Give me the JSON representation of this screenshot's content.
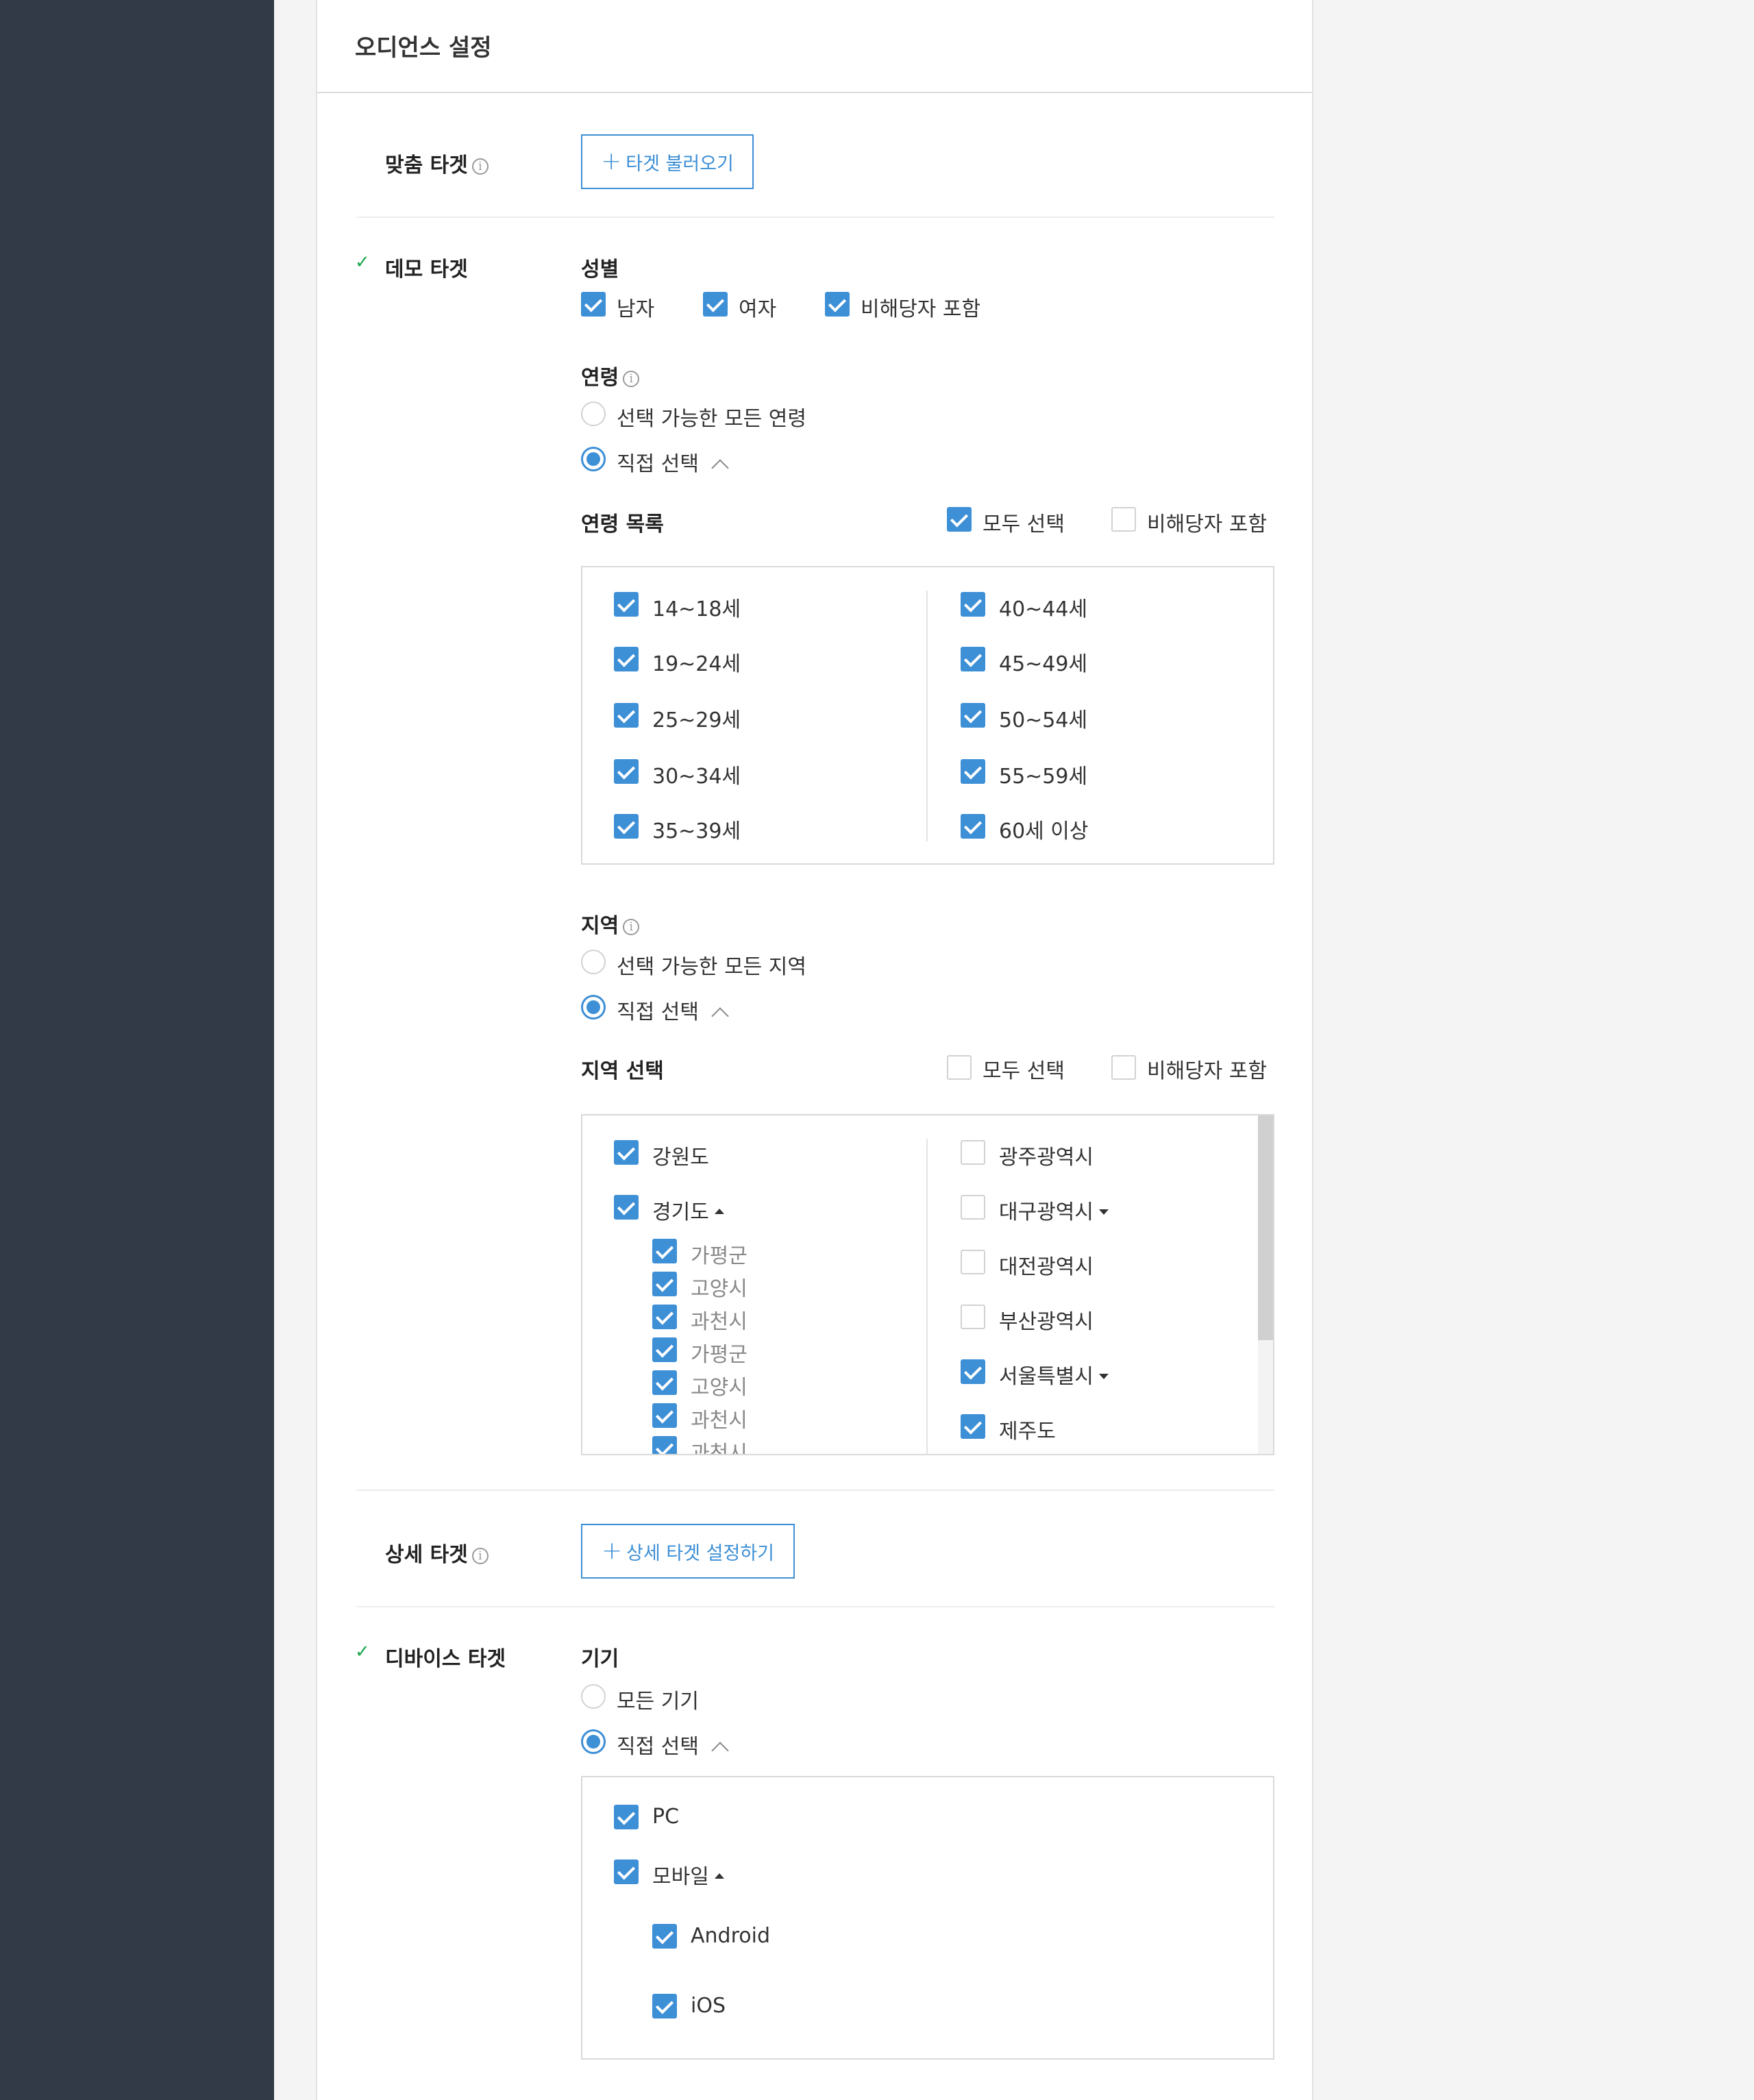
{
  "page": {
    "title": "오디언스 설정"
  },
  "custom_target": {
    "label": "맞춤 타겟",
    "button": "타겟 불러오기"
  },
  "demo_target": {
    "label": "데모 타겟",
    "gender": {
      "title": "성별",
      "options": [
        {
          "label": "남자",
          "checked": true
        },
        {
          "label": "여자",
          "checked": true
        },
        {
          "label": "비해당자 포함",
          "checked": true
        }
      ]
    },
    "age": {
      "title": "연령",
      "radio_all": "선택 가능한 모든 연령",
      "radio_custom": "직접 선택",
      "list_title": "연령 목록",
      "select_all": "모두 선택",
      "select_all_checked": true,
      "include_na": "비해당자 포함",
      "include_na_checked": false,
      "left": [
        "14~18세",
        "19~24세",
        "25~29세",
        "30~34세",
        "35~39세"
      ],
      "right": [
        "40~44세",
        "45~49세",
        "50~54세",
        "55~59세",
        "60세 이상"
      ]
    },
    "region": {
      "title": "지역",
      "radio_all": "선택 가능한 모든 지역",
      "radio_custom": "직접 선택",
      "list_title": "지역 선택",
      "select_all": "모두 선택",
      "select_all_checked": false,
      "include_na": "비해당자 포함",
      "include_na_checked": false,
      "left": [
        {
          "label": "강원도",
          "checked": true
        },
        {
          "label": "경기도",
          "checked": true,
          "expanded": true
        }
      ],
      "left_children": [
        "가평군",
        "고양시",
        "과천시",
        "가평군",
        "고양시",
        "과천시",
        "과천시"
      ],
      "right": [
        {
          "label": "광주광역시",
          "checked": false
        },
        {
          "label": "대구광역시",
          "checked": false,
          "has_children": true
        },
        {
          "label": "대전광역시",
          "checked": false
        },
        {
          "label": "부산광역시",
          "checked": false
        },
        {
          "label": "서울특별시",
          "checked": true,
          "has_children": true
        },
        {
          "label": "제주도",
          "checked": true
        }
      ]
    }
  },
  "detail_target": {
    "label": "상세 타겟",
    "button": "상세 타겟 설정하기"
  },
  "device_target": {
    "label": "디바이스 타겟",
    "device": {
      "title": "기기",
      "radio_all": "모든 기기",
      "radio_custom": "직접 선택",
      "items": [
        {
          "label": "PC",
          "checked": true
        },
        {
          "label": "모바일",
          "checked": true,
          "expanded": true
        }
      ],
      "children": [
        "Android",
        "iOS"
      ]
    }
  },
  "colors": {
    "accent": "#3d8fd6",
    "sidebar": "#323a48",
    "success": "#1aa64b"
  },
  "icons": [
    "info-icon",
    "check-icon",
    "plus-icon",
    "chevron-up-icon",
    "caret-up-icon",
    "caret-down-icon"
  ]
}
